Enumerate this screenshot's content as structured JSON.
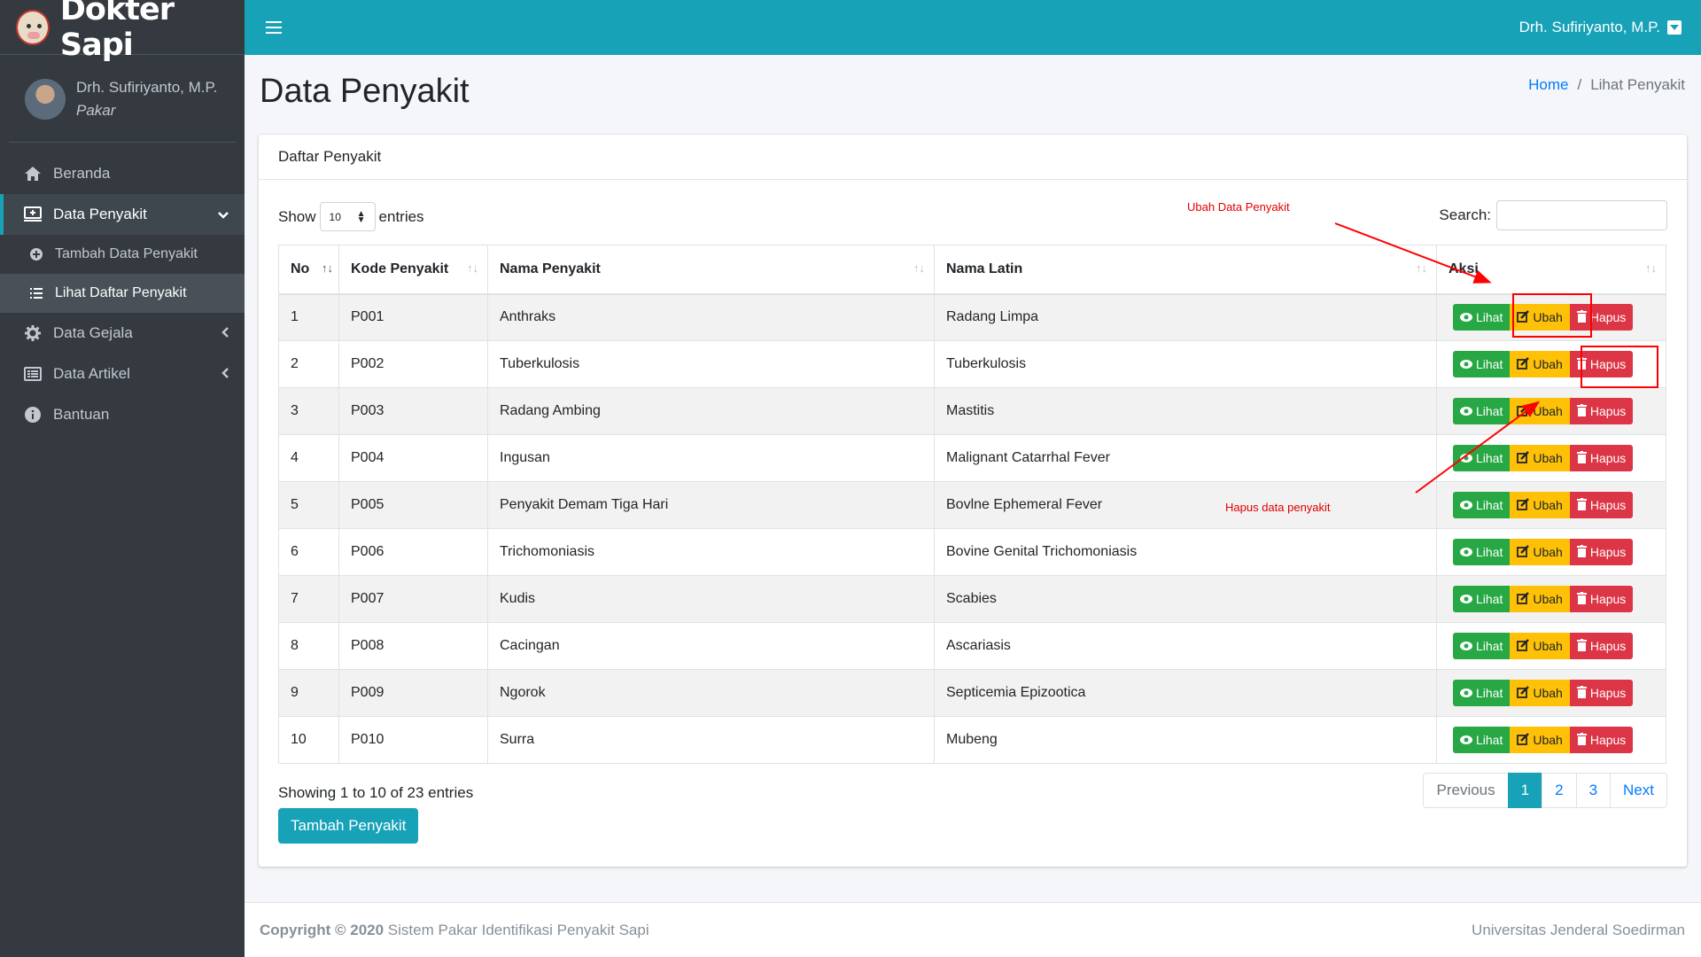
{
  "brand": {
    "name": "Dokter Sapi"
  },
  "user": {
    "name": "Drh. Sufiriyanto, M.P.",
    "role": "Pakar"
  },
  "sidebar": {
    "items": [
      {
        "label": "Beranda",
        "icon": "home-icon"
      },
      {
        "label": "Data Penyakit",
        "icon": "hospital-icon"
      },
      {
        "label": "Data Gejala",
        "icon": "gear-icon"
      },
      {
        "label": "Data Artikel",
        "icon": "list-alt-icon"
      },
      {
        "label": "Bantuan",
        "icon": "info-icon"
      }
    ],
    "subitems": [
      {
        "label": "Tambah Data Penyakit",
        "icon": "plus-circle-icon"
      },
      {
        "label": "Lihat Daftar Penyakit",
        "icon": "list-icon"
      }
    ]
  },
  "header": {
    "user": "Drh. Sufiriyanto, M.P."
  },
  "page": {
    "title": "Data Penyakit"
  },
  "breadcrumb": {
    "home": "Home",
    "current": "Lihat Penyakit",
    "separator": "/"
  },
  "card": {
    "title": "Daftar Penyakit"
  },
  "datatable": {
    "show": "Show",
    "length_value": "10",
    "entries": "entries",
    "search_label": "Search:",
    "search_value": "",
    "columns": [
      "No",
      "Kode Penyakit",
      "Nama Penyakit",
      "Nama Latin",
      "Aksi"
    ],
    "rows": [
      {
        "no": "1",
        "kode": "P001",
        "nama": "Anthraks",
        "latin": "Radang Limpa"
      },
      {
        "no": "2",
        "kode": "P002",
        "nama": "Tuberkulosis",
        "latin": "Tuberkulosis"
      },
      {
        "no": "3",
        "kode": "P003",
        "nama": "Radang Ambing",
        "latin": "Mastitis"
      },
      {
        "no": "4",
        "kode": "P004",
        "nama": "Ingusan",
        "latin": "Malignant Catarrhal Fever"
      },
      {
        "no": "5",
        "kode": "P005",
        "nama": "Penyakit Demam Tiga Hari",
        "latin": "Bovlne Ephemeral Fever"
      },
      {
        "no": "6",
        "kode": "P006",
        "nama": "Trichomoniasis",
        "latin": "Bovine Genital Trichomoniasis"
      },
      {
        "no": "7",
        "kode": "P007",
        "nama": "Kudis",
        "latin": "Scabies"
      },
      {
        "no": "8",
        "kode": "P008",
        "nama": "Cacingan",
        "latin": "Ascariasis"
      },
      {
        "no": "9",
        "kode": "P009",
        "nama": "Ngorok",
        "latin": "Septicemia Epizootica"
      },
      {
        "no": "10",
        "kode": "P010",
        "nama": "Surra",
        "latin": "Mubeng"
      }
    ],
    "actions": {
      "view": "Lihat",
      "edit": "Ubah",
      "delete": "Hapus"
    },
    "info": "Showing 1 to 10 of 23 entries",
    "pagination": {
      "previous": "Previous",
      "pages": [
        "1",
        "2",
        "3"
      ],
      "active": "1",
      "next": "Next"
    }
  },
  "add_button": "Tambah Penyakit",
  "footer": {
    "copyright_bold": "Copyright © 2020",
    "copyright_text": "Sistem Pakar Identifikasi Penyakit Sapi",
    "right": "Universitas Jenderal Soedirman"
  },
  "annotations": {
    "edit": "Ubah Data Penyakit",
    "delete": "Hapus data penyakit"
  },
  "colors": {
    "primary": "#17a2b8",
    "sidebar": "#343a40",
    "success": "#28a745",
    "warning": "#ffc107",
    "danger": "#dc3545",
    "annotation": "#ff0000"
  }
}
